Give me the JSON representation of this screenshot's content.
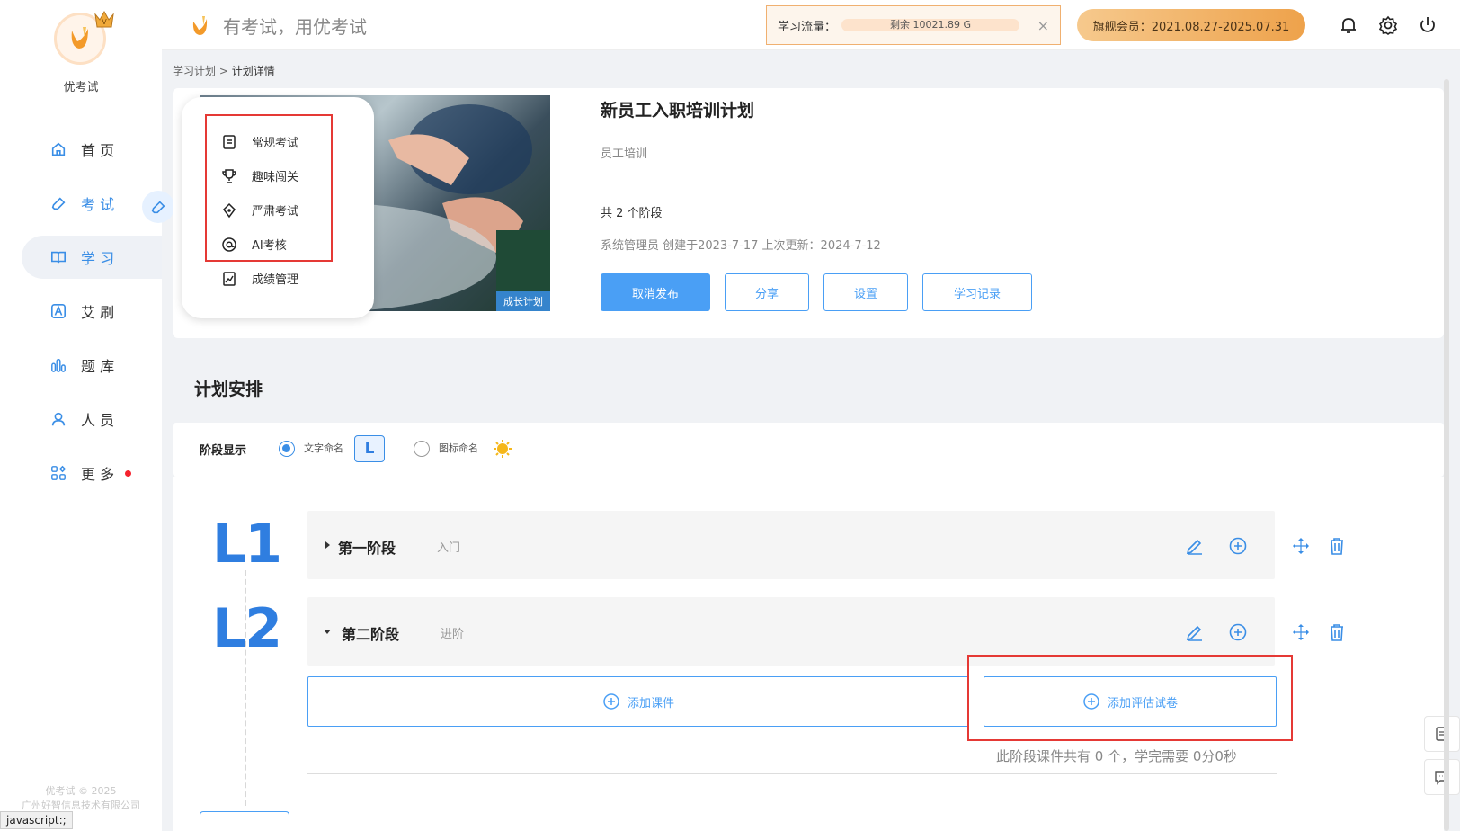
{
  "app": {
    "name": "优考试",
    "slogan": "有考试，用优考试"
  },
  "sidebar": {
    "items": [
      {
        "label": "首 页",
        "icon": "home-icon"
      },
      {
        "label": "考 试",
        "icon": "eraser-icon"
      },
      {
        "label": "学 习",
        "icon": "book-icon"
      },
      {
        "label": "艾 刷",
        "icon": "a-badge-icon"
      },
      {
        "label": "题 库",
        "icon": "bar-chart-icon"
      },
      {
        "label": "人 员",
        "icon": "user-icon"
      },
      {
        "label": "更 多",
        "icon": "apps-icon"
      }
    ],
    "footer_line1": "优考试 © 2025",
    "footer_line2": "广州好智信息技术有限公司",
    "status_url": "javascript:;"
  },
  "topbar": {
    "traffic_label": "学习流量：",
    "traffic_remaining": "剩余 10021.89 G",
    "close_symbol": "×",
    "member": "旗舰会员：2021.08.27-2025.07.31"
  },
  "breadcrumb": {
    "parent": "学习计划",
    "separator": " > ",
    "current": "计划详情"
  },
  "exam_menu": {
    "items": [
      {
        "label": "常规考试",
        "icon": "document-icon"
      },
      {
        "label": "趣味闯关",
        "icon": "trophy-icon"
      },
      {
        "label": "严肃考试",
        "icon": "pen-nib-icon"
      },
      {
        "label": "AI考核",
        "icon": "ai-at-icon"
      },
      {
        "label": "成绩管理",
        "icon": "score-icon"
      }
    ]
  },
  "plan": {
    "badge": "成长计划",
    "title": "新员工入职培训计划",
    "category": "员工培训",
    "stages_count": "共 2 个阶段",
    "meta": "系统管理员 创建于2023-7-17 上次更新：2024-7-12",
    "buttons": {
      "unpublish": "取消发布",
      "share": "分享",
      "settings": "设置",
      "records": "学习记录"
    }
  },
  "schedule": {
    "title": "计划安排",
    "display_label": "阶段显示",
    "option_text": "文字命名",
    "option_icon": "图标命名",
    "l_badge": "L",
    "stages": [
      {
        "num": "L1",
        "name": "第一阶段",
        "sub": "入门"
      },
      {
        "num": "L2",
        "name": "第二阶段",
        "sub": "进阶"
      }
    ],
    "add_course": "添加课件",
    "add_assessment": "添加评估试卷",
    "stage_info": "此阶段课件共有 0 个，学完需要 0分0秒"
  },
  "colors": {
    "accent": "#3a8ee6",
    "highlight": "#e53935",
    "member_gold": "#eea24b"
  }
}
